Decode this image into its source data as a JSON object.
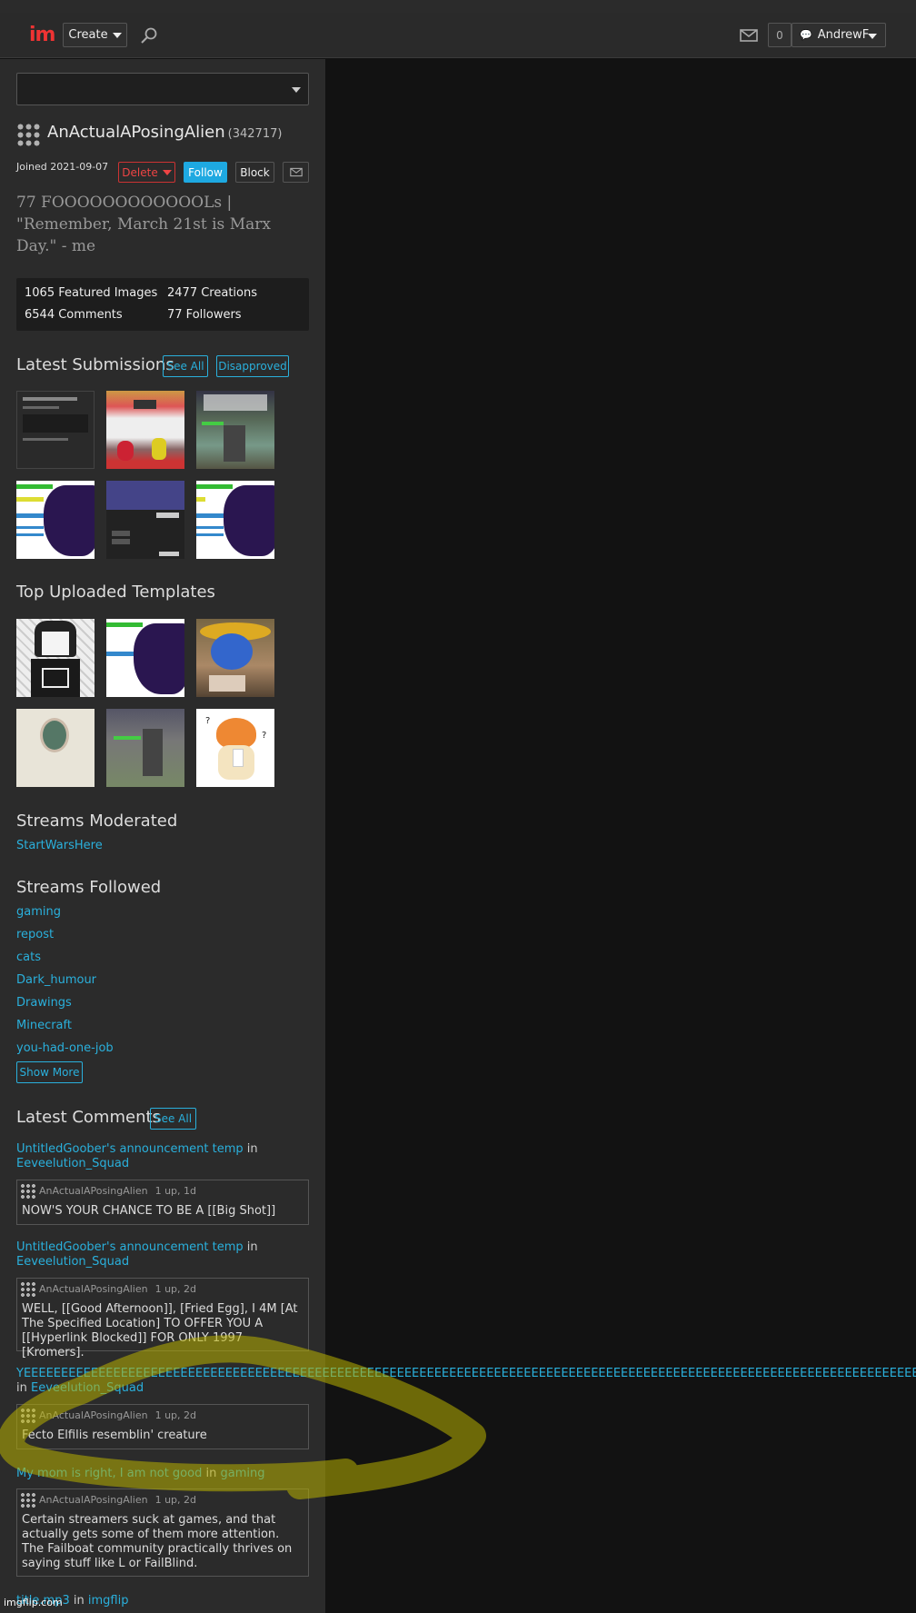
{
  "header": {
    "logo_i": "i",
    "logo_m": "m",
    "create_label": "Create",
    "notif_count": "0",
    "username": "AndrewF"
  },
  "profile": {
    "username": "AnActualAPosingAlien",
    "user_id": "(342717)",
    "joined": "Joined 2021-09-07",
    "delete_label": "Delete",
    "follow_label": "Follow",
    "block_label": "Block",
    "bio": "77 FOOOOOOOOOOOOLs | \"Remember, March 21st is Marx Day.\" - me",
    "stats": {
      "featured": "1065 Featured Images",
      "creations": "2477 Creations",
      "comments": "6544 Comments",
      "followers": "77 Followers"
    }
  },
  "latest_submissions": {
    "title": "Latest Submissions",
    "see_all": "See All",
    "disapproved": "Disapproved"
  },
  "top_templates": {
    "title": "Top Uploaded Templates"
  },
  "streams_moderated": {
    "title": "Streams Moderated",
    "items": [
      "StartWarsHere"
    ]
  },
  "streams_followed": {
    "title": "Streams Followed",
    "items": [
      "gaming",
      "repost",
      "cats",
      "Dark_humour",
      "Drawings",
      "Minecraft",
      "you-had-one-job"
    ],
    "show_more": "Show More"
  },
  "latest_comments": {
    "title": "Latest Comments",
    "see_all": "See All",
    "in_word": "in",
    "items": [
      {
        "post": "UntitledGoober's announcement temp",
        "stream": "Eeveelution_Squad",
        "author": "AnActualAPosingAlien",
        "meta": "1 up, 1d",
        "text": "NOW'S YOUR CHANCE TO BE A [[Big Shot]]"
      },
      {
        "post": "UntitledGoober's announcement temp",
        "stream": "Eeveelution_Squad",
        "author": "AnActualAPosingAlien",
        "meta": "1 up, 2d",
        "text": "WELL, [[Good Afternoon]], [Fried Egg], I 4M [At The Specified Location] TO OFFER YOU A [[Hyperlink Blocked]] FOR ONLY 1997 [Kromers]."
      },
      {
        "post": "YEEEEEEEEEEEEEEEEEEEEEEEEEEEEEEEEEEEEEEEEEEEEEEEEEEEEEEEEEEEEEEEEEEEEEEEEEEEEEEEEEEEEEEEEEEEEEEEEEEEEEEEEEEEEEEEEEEEEEEEEEEEEEEEEEEEEE",
        "stream": "Eeveelution_Squad",
        "author": "AnActualAPosingAlien",
        "meta": "1 up, 2d",
        "text": "Fecto Elfilis resemblin' creature"
      },
      {
        "post": "My mom is right, I am not good",
        "stream": "gaming",
        "author": "AnActualAPosingAlien",
        "meta": "1 up, 2d",
        "text": "Certain streamers suck at games, and that actually gets some of them more attention. The Failboat community practically thrives on saying stuff like L or FailBlind."
      },
      {
        "post": "title.mp3",
        "stream": "imgflip"
      }
    ]
  },
  "watermark": "imgflip.com"
}
